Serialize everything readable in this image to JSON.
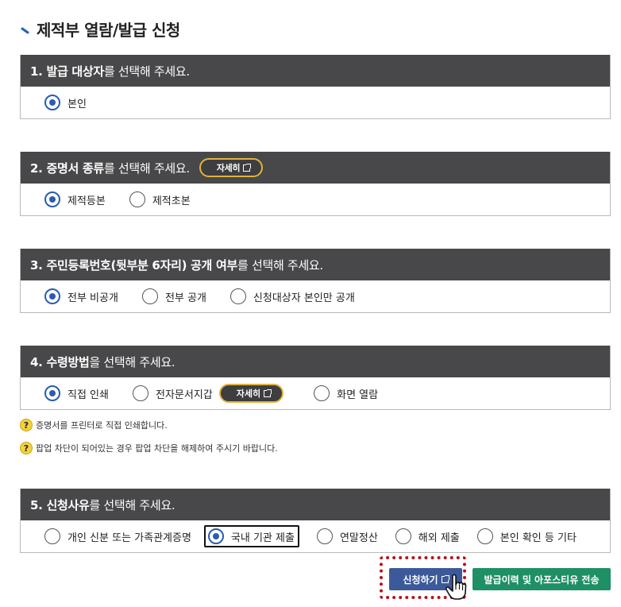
{
  "page": {
    "title": "제적부 열람/발급 신청"
  },
  "sections": [
    {
      "head_bold": "1. 발급 대상자",
      "head_rest": "를 선택해 주세요.",
      "options": [
        {
          "label": "본인",
          "checked": true
        }
      ]
    },
    {
      "head_bold": "2. 증명서 종류",
      "head_rest": "를 선택해 주세요.",
      "detail_label": "자세히",
      "options": [
        {
          "label": "제적등본",
          "checked": true
        },
        {
          "label": "제적초본",
          "checked": false
        }
      ]
    },
    {
      "head_bold": "3. 주민등록번호(뒷부분 6자리) 공개 여부",
      "head_rest": "를 선택해 주세요.",
      "options": [
        {
          "label": "전부 비공개",
          "checked": true
        },
        {
          "label": "전부 공개",
          "checked": false
        },
        {
          "label": "신청대상자 본인만 공개",
          "checked": false
        }
      ]
    },
    {
      "head_bold": "4. 수령방법",
      "head_rest": "을 선택해 주세요.",
      "detail_label": "자세히",
      "options": [
        {
          "label": "직접 인쇄",
          "checked": true
        },
        {
          "label": "전자문서지갑",
          "checked": false
        },
        {
          "label": "화면 열람",
          "checked": false
        }
      ]
    },
    {
      "head_bold": "5. 신청사유",
      "head_rest": "를 선택해 주세요.",
      "options": [
        {
          "label": "개인 신분 또는 가족관계증명",
          "checked": false
        },
        {
          "label": "국내 기관 제출",
          "checked": true
        },
        {
          "label": "연말정산",
          "checked": false
        },
        {
          "label": "해외 제출",
          "checked": false
        },
        {
          "label": "본인 확인 등 기타",
          "checked": false
        }
      ]
    }
  ],
  "notes": [
    "증명서를 프린터로 직접 인쇄합니다.",
    "팝업 차단이 되어있는 경우 팝업 차단을 해제하여 주시기 바랍니다."
  ],
  "buttons": {
    "apply": "신청하기",
    "history": "발급이력 및 아포스티유 전송"
  },
  "icons": {
    "help": "question-icon",
    "external": "external-link-icon",
    "pointer": "hand-pointer-icon"
  },
  "colors": {
    "header_bg": "#48484a",
    "radio_checked": "#2a5db0",
    "apply_bg": "#3c5a9a",
    "history_bg": "#1f8f66",
    "highlight": "#b5121b",
    "detail_border": "#e2b23c"
  }
}
